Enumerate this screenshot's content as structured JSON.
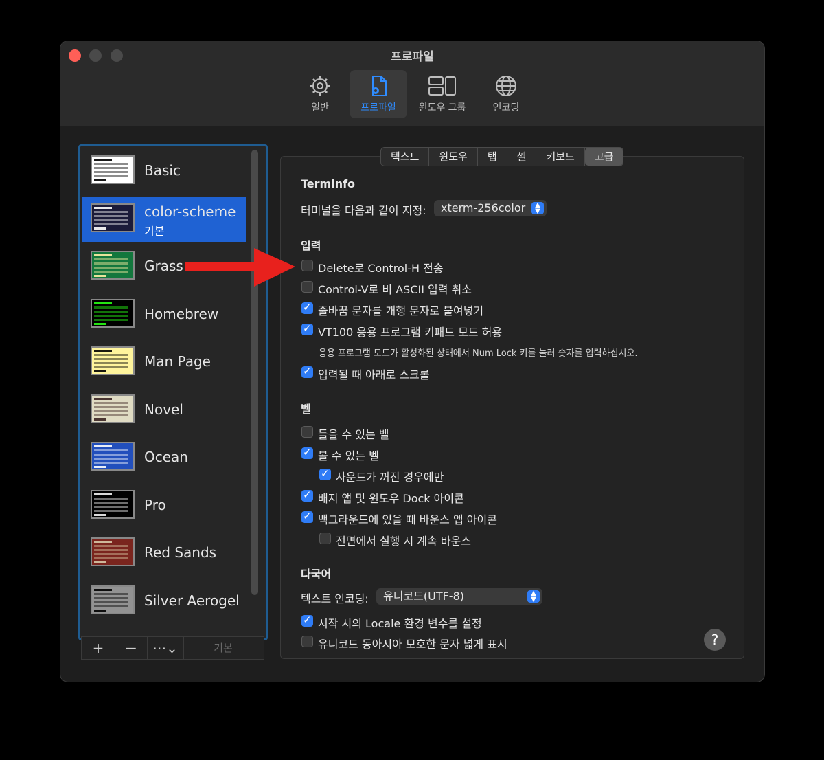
{
  "window": {
    "title": "프로파일"
  },
  "toolbar": [
    {
      "label": "일반",
      "icon": "gear-icon"
    },
    {
      "label": "프로파일",
      "icon": "profile-document-icon",
      "active": true
    },
    {
      "label": "윈도우 그룹",
      "icon": "window-group-icon"
    },
    {
      "label": "인코딩",
      "icon": "globe-icon"
    }
  ],
  "profiles": [
    {
      "name": "Basic",
      "bg": "#ffffff",
      "fg": "#000000"
    },
    {
      "name": "color-scheme",
      "sub": "기본",
      "bg": "#1b1b3a",
      "fg": "#ffffff",
      "selected": true
    },
    {
      "name": "Grass",
      "bg": "#13773d",
      "fg": "#fff0a5"
    },
    {
      "name": "Homebrew",
      "bg": "#000000",
      "fg": "#28fe14"
    },
    {
      "name": "Man Page",
      "bg": "#fef49c",
      "fg": "#000000"
    },
    {
      "name": "Novel",
      "bg": "#dfdbc3",
      "fg": "#3b2322"
    },
    {
      "name": "Ocean",
      "bg": "#224fbc",
      "fg": "#ffffff"
    },
    {
      "name": "Pro",
      "bg": "#000000",
      "fg": "#f2f2f2"
    },
    {
      "name": "Red Sands",
      "bg": "#7a251e",
      "fg": "#d7c9a7"
    },
    {
      "name": "Silver Aerogel",
      "bg": "#929292",
      "fg": "#000000"
    }
  ],
  "list_buttons": {
    "add": "+",
    "remove": "—",
    "more": "⋯⌄",
    "default": "기본"
  },
  "tabs": [
    {
      "label": "텍스트"
    },
    {
      "label": "윈도우"
    },
    {
      "label": "탭"
    },
    {
      "label": "셸"
    },
    {
      "label": "키보드"
    },
    {
      "label": "고급",
      "active": true
    }
  ],
  "terminfo": {
    "heading": "Terminfo",
    "label": "터미널을 다음과 같이 지정:",
    "value": "xterm-256color"
  },
  "input": {
    "heading": "입력",
    "options": [
      {
        "label": "Delete로 Control-H 전송",
        "checked": false
      },
      {
        "label": "Control-V로 비 ASCII 입력 취소",
        "checked": false
      },
      {
        "label": "줄바꿈 문자를 개행 문자로 붙여넣기",
        "checked": true
      },
      {
        "label": "VT100 응용 프로그램 키패드 모드 허용",
        "checked": true
      }
    ],
    "note": "응용 프로그램 모드가 활성화된 상태에서 Num Lock 키를 눌러 숫자를 입력하십시오.",
    "scroll_option": {
      "label": "입력될 때 아래로 스크롤",
      "checked": true
    }
  },
  "bell": {
    "heading": "벨",
    "options": [
      {
        "label": "들을 수 있는 벨",
        "checked": false
      },
      {
        "label": "볼 수 있는 벨",
        "checked": true
      },
      {
        "label": "사운드가 꺼진 경우에만",
        "checked": true
      },
      {
        "label": "배지 앱 및 윈도우 Dock 아이콘",
        "checked": true
      },
      {
        "label": "백그라운드에 있을 때 바운스 앱 아이콘",
        "checked": true
      },
      {
        "label": "전면에서 실행 시 계속 바운스",
        "checked": false
      }
    ]
  },
  "intl": {
    "heading": "다국어",
    "encoding_label": "텍스트 인코딩:",
    "encoding_value": "유니코드(UTF-8)",
    "options": [
      {
        "label": "시작 시의 Locale 환경 변수를 설정",
        "checked": true
      },
      {
        "label": "유니코드 동아시아 모호한 문자 넓게 표시",
        "checked": false
      }
    ]
  },
  "help": "?",
  "colors": {
    "accent": "#2f7cf6",
    "selection": "#1f62d3",
    "arrow": "#e8211d"
  }
}
